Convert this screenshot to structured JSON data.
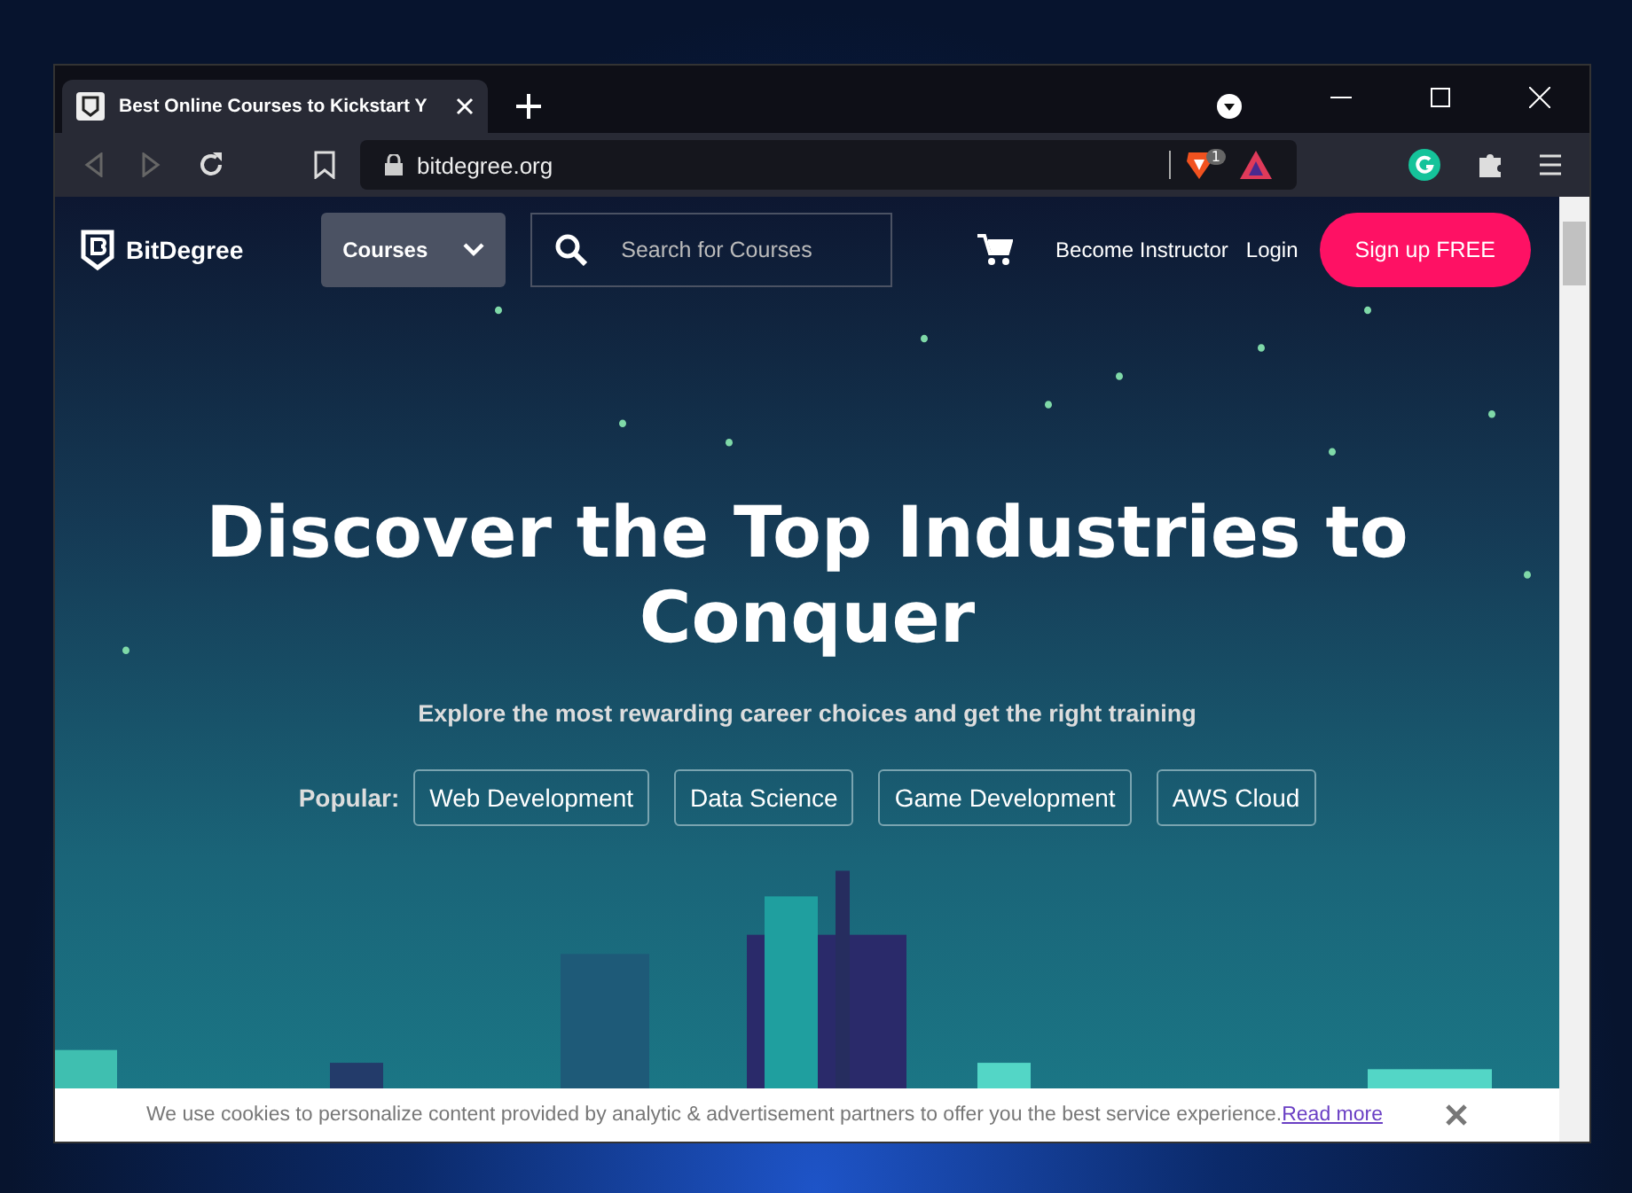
{
  "browser": {
    "tab_title": "Best Online Courses to Kickstart Y",
    "address": "bitdegree.org",
    "shield_count": "1"
  },
  "site_nav": {
    "logo": "BitDegree",
    "courses_menu": "Courses",
    "search_placeholder": "Search for Courses",
    "links": [
      "Become Instructor",
      "Login"
    ],
    "signup": "Sign up FREE"
  },
  "hero": {
    "title": "Discover the Top Industries to Conquer",
    "subtitle": "Explore the most rewarding career choices and get the right training",
    "popular_label": "Popular:",
    "tags": [
      "Web Development",
      "Data Science",
      "Game Development",
      "AWS Cloud"
    ]
  },
  "cookie_bar": {
    "text": "We use cookies to personalize content provided by analytic & advertisement partners to offer you the best service experience.",
    "link": "Read more"
  }
}
